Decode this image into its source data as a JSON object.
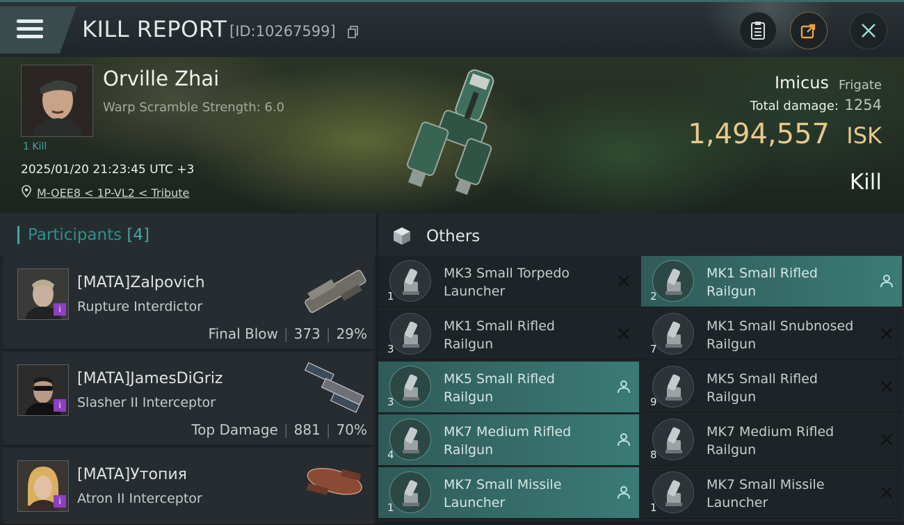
{
  "header": {
    "title": "KILL REPORT",
    "report_id": "[ID:10267599]",
    "icons": [
      "menu-icon",
      "copy-icon",
      "clipboard-icon",
      "share-icon",
      "close-icon"
    ]
  },
  "victim": {
    "name": "Orville Zhai",
    "warp_scramble": "Warp Scramble Strength: 6.0",
    "kill_count": "1 Kill",
    "time": "2025/01/20 21:23:45 UTC +3",
    "location": "M-OEE8 < 1P-VL2 < Tribute"
  },
  "ship": {
    "name": "Imicus",
    "class": "Frigate",
    "damage_label": "Total damage:",
    "damage_value": "1254",
    "isk_value": "1,494,557",
    "isk_unit": "ISK",
    "kill_type": "Kill"
  },
  "participants": {
    "title": "Participants",
    "count": "[4]",
    "items": [
      {
        "name": "[MATA]Zalpovich",
        "ship": "Rupture Interdictor",
        "label": "Final Blow",
        "damage": "373",
        "percent": "29%"
      },
      {
        "name": "[MATA]JamesDiGriz",
        "ship": "Slasher II Interceptor",
        "label": "Top Damage",
        "damage": "881",
        "percent": "70%"
      },
      {
        "name": "[MATA]Утопия",
        "ship": "Atron II Interceptor",
        "label": "",
        "damage": "",
        "percent": ""
      }
    ]
  },
  "others": {
    "title": "Others",
    "items": [
      {
        "qty": "1",
        "name": "MK3 Small Torpedo Launcher",
        "highlight": false,
        "action": "close"
      },
      {
        "qty": "2",
        "name": "MK1 Small Rifled Railgun",
        "highlight": true,
        "action": "person"
      },
      {
        "qty": "3",
        "name": "MK1 Small Rifled Railgun",
        "highlight": false,
        "action": "close"
      },
      {
        "qty": "7",
        "name": "MK1 Small Snubnosed Railgun",
        "highlight": false,
        "action": "close"
      },
      {
        "qty": "3",
        "name": "MK5 Small Rifled Railgun",
        "highlight": true,
        "action": "person"
      },
      {
        "qty": "9",
        "name": "MK5 Small Rifled Railgun",
        "highlight": false,
        "action": "close"
      },
      {
        "qty": "4",
        "name": "MK7 Medium Rifled Railgun",
        "highlight": true,
        "action": "person"
      },
      {
        "qty": "8",
        "name": "MK7 Medium Rifled Railgun",
        "highlight": false,
        "action": "close"
      },
      {
        "qty": "1",
        "name": "MK7 Small Missile Launcher",
        "highlight": true,
        "action": "person"
      },
      {
        "qty": "1",
        "name": "MK7 Small Missile Launcher",
        "highlight": false,
        "action": "close"
      }
    ]
  },
  "colors": {
    "accent": "#3fa9a6",
    "isk": "#e8c98a",
    "highlight_row": "#3b7b76",
    "badge": "#8d3fbf"
  }
}
